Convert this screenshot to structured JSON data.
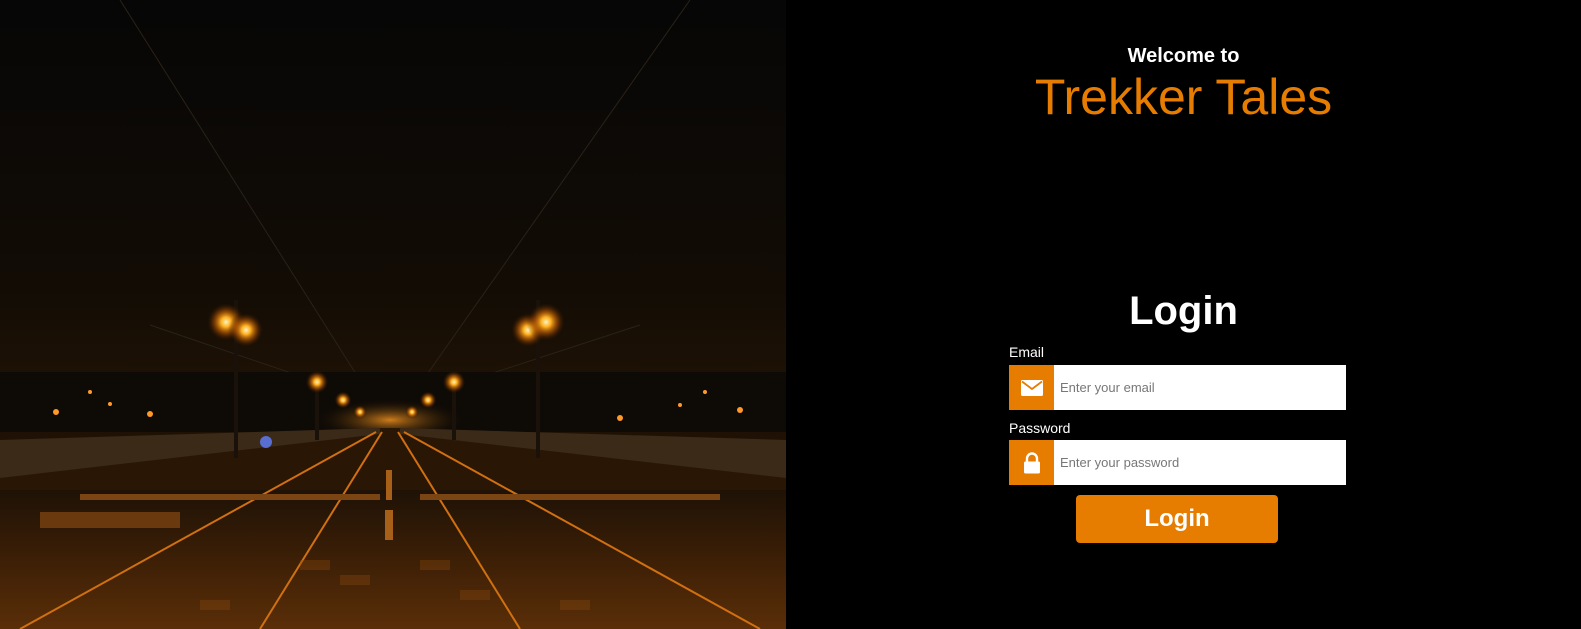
{
  "header": {
    "welcome": "Welcome to",
    "brand": "Trekker Tales"
  },
  "login": {
    "title": "Login",
    "email_label": "Email",
    "email_placeholder": "Enter your email",
    "email_value": "",
    "password_label": "Password",
    "password_placeholder": "Enter your password",
    "password_value": "",
    "submit_label": "Login"
  },
  "theme": {
    "accent": "#e67c00",
    "background": "#000000",
    "text": "#ffffff"
  },
  "icons": {
    "email": "envelope-icon",
    "password": "lock-icon"
  }
}
